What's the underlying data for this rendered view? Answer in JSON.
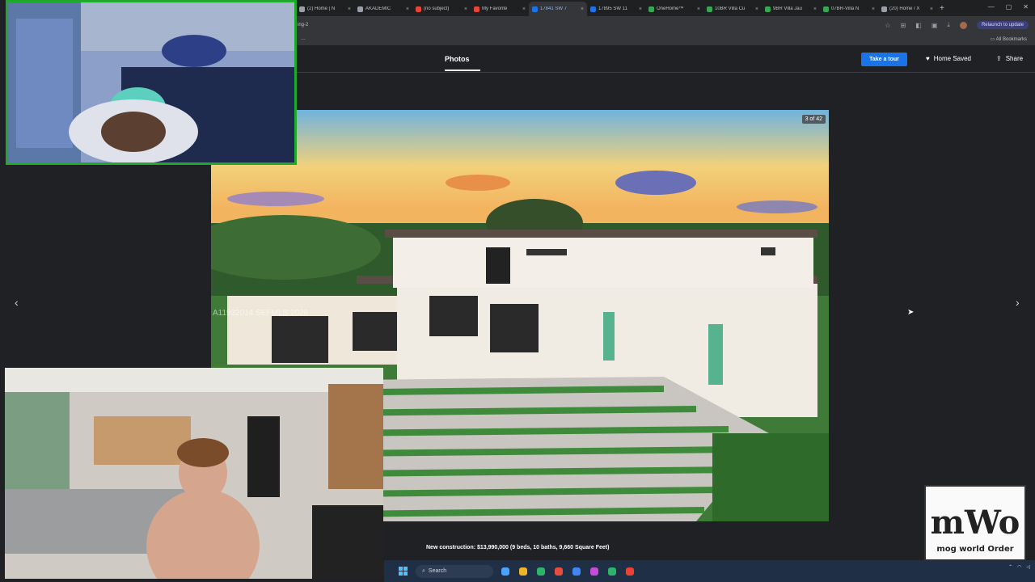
{
  "browser": {
    "tabs": [
      {
        "label": "(2) Home | N",
        "color": "#9aa0a6"
      },
      {
        "label": "AKADEMIC",
        "color": "#9aa0a6"
      },
      {
        "label": "(no subject)",
        "color": "#ea4335"
      },
      {
        "label": "My Favorite",
        "color": "#ea4335"
      },
      {
        "label": "17841 SW 7",
        "color": "#1a73e8"
      },
      {
        "label": "17895 SW 11",
        "color": "#1a73e8"
      },
      {
        "label": "OneHome™",
        "color": "#34a853"
      },
      {
        "label": "10BR Villa Cu",
        "color": "#34a853"
      },
      {
        "label": "9BR Villa Jau",
        "color": "#34a853"
      },
      {
        "label": "07BR-Villa N",
        "color": "#34a853"
      },
      {
        "label": "(20) Home / X",
        "color": "#9aa0a6"
      }
    ],
    "active_tab_index": 4,
    "url": "ing-2",
    "relaunch_label": "Relaunch to update",
    "all_bookmarks": "All Bookmarks"
  },
  "site": {
    "photos_tab": "Photos",
    "take_tour": "Take a tour",
    "home_saved": "Home Saved",
    "share": "Share"
  },
  "gallery": {
    "counter": "3 of 42",
    "watermark": "A11932014 SEFMLS 2026",
    "caption": "New construction: $13,990,000 (9 beds, 10 baths, 9,660 Square Feet)"
  },
  "logo": {
    "main": "mWo",
    "sub": "mog world Order"
  },
  "taskbar": {
    "search_placeholder": "Search",
    "apps": [
      "#4aa3ff",
      "#f0b429",
      "#2fb36b",
      "#e94b3c",
      "#4285f4",
      "#c64bd6",
      "#2fb36b",
      "#ea4335"
    ]
  }
}
